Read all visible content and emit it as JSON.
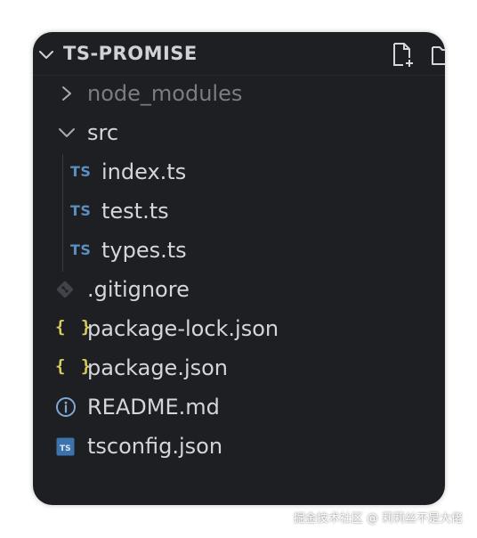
{
  "explorer": {
    "title": "TS-PROMISE",
    "new_file_icon": "new-file-icon",
    "new_folder_icon": "new-folder-icon"
  },
  "tree": {
    "node_modules": "node_modules",
    "src": "src",
    "index_ts": "index.ts",
    "test_ts": "test.ts",
    "types_ts": "types.ts",
    "gitignore": ".gitignore",
    "package_lock": "package-lock.json",
    "package_json": "package.json",
    "readme": "README.md",
    "tsconfig": "tsconfig.json",
    "ts_badge": "TS",
    "json_badge": "{ }"
  },
  "colors": {
    "panel_bg": "#1e1f23",
    "text": "#d4d6da",
    "dim_text": "#7b7d83",
    "ts_icon": "#5b8fc2",
    "json_icon": "#d8cc5c"
  },
  "watermark": "掘金技术社区 @ 莉莉丝不是大佬"
}
